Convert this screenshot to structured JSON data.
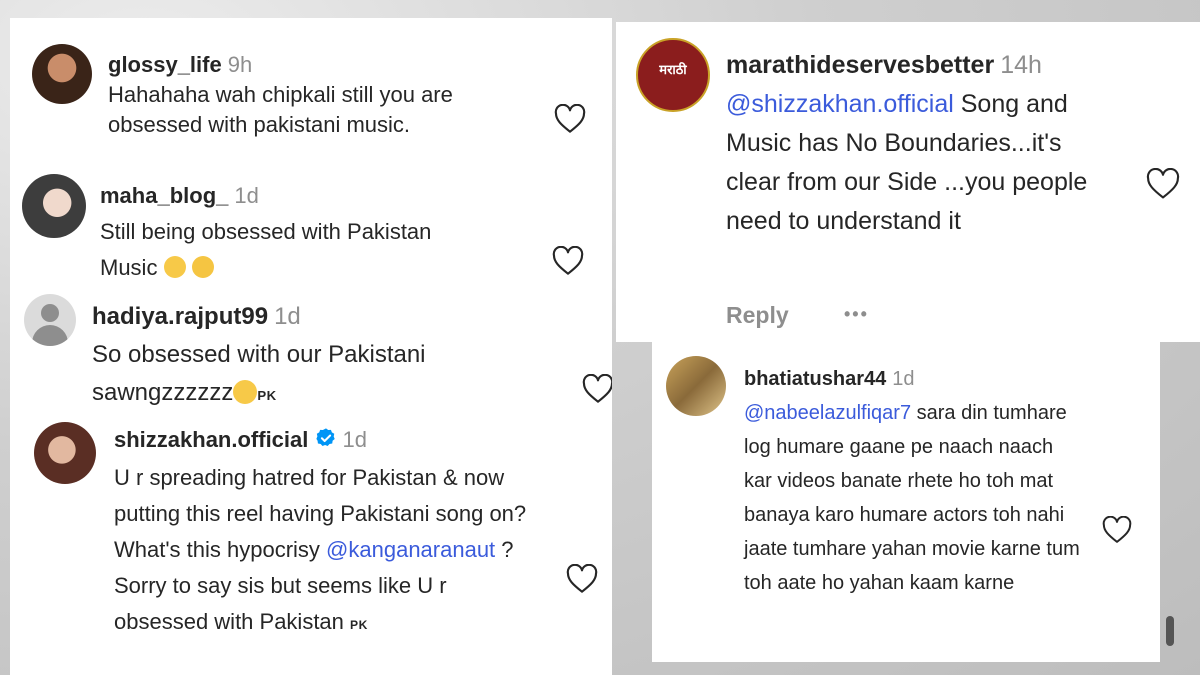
{
  "comments_left": [
    {
      "username": "glossy_life",
      "time": "9h",
      "text": "Hahahaha wah chipkali still you are obsessed with pakistani music."
    },
    {
      "username": "maha_blog_",
      "time": "1d",
      "text_line1": "Still being obsessed with Pakistan",
      "text_line2": "Music"
    },
    {
      "username": "hadiya.rajput99",
      "time": "1d",
      "text_line1": "So obsessed with our Pakistani",
      "text_line2": "sawngzzzzzz",
      "flag": "PK"
    },
    {
      "username": "shizzakhan.official",
      "time": "1d",
      "text_part1": "U r spreading hatred for Pakistan & now putting this reel having Pakistani song on? What's this hypocrisy ",
      "mention": "@kanganaranaut",
      "text_part2": " ? Sorry to say sis but seems like U r obsessed with Pakistan",
      "flag": "PK"
    }
  ],
  "comments_right": [
    {
      "username": "marathideservesbetter",
      "time": "14h",
      "mention": "@shizzakhan.official",
      "text": " Song and Music has No Boundaries...it's clear from our Side ...you people need to understand it",
      "reply_label": "Reply",
      "more_label": "•••",
      "avatar_text": "मराठी"
    },
    {
      "username": "bhatiatushar44",
      "time": "1d",
      "mention": "@nabeelazulfiqar7",
      "text": " sara din tumhare log humare gaane pe naach naach kar videos banate rhete ho toh mat banaya karo humare actors toh nahi jaate tumhare yahan movie karne tum toh aate ho yahan kaam karne"
    }
  ],
  "icons": {
    "heart": "heart-outline-icon",
    "verified": "verified-badge-icon"
  },
  "colors": {
    "mention": "#3b5bdb",
    "time": "#8e8e8e",
    "verified": "#0095f6"
  }
}
